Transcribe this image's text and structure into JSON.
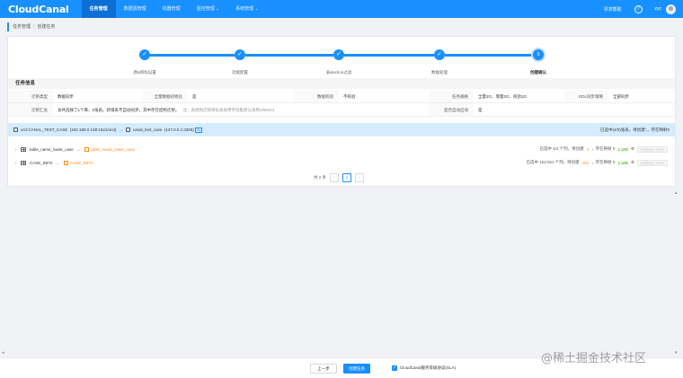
{
  "app": {
    "logo": "CloudCanal",
    "nav": [
      "任务管理",
      "数据源管理",
      "机器管理",
      "监控管理",
      "系统管理"
    ],
    "nav_dropdowns": [
      "监控管理",
      "系统管理"
    ],
    "active_nav": "任务管理",
    "consult": "寻求帮助",
    "help_icon": "?",
    "user": "zyc"
  },
  "breadcrumb": [
    "任务管理",
    "创建任务"
  ],
  "steps": [
    {
      "label": "源&目标设置",
      "icon": "✓"
    },
    {
      "label": "功能配置",
      "icon": "✓"
    },
    {
      "label": "表&action过滤",
      "icon": "✓"
    },
    {
      "label": "数据处理",
      "icon": "✓"
    },
    {
      "label": "创建确认",
      "icon": "5"
    }
  ],
  "section_title": "任务信息",
  "info": {
    "row1": [
      {
        "label": "迁移类型",
        "value": "数据同步"
      },
      {
        "label": "全量数据初始化",
        "value": "是"
      },
      {
        "label": "数据校验",
        "value": "不校验"
      },
      {
        "label": "任务规格",
        "value": "全量2G、增量2G、校验2G"
      },
      {
        "label": "DDL同步策略",
        "value": "全部同步"
      }
    ],
    "row2": {
      "label1": "迁移汇总",
      "value1": "总共选择了1个库、2张表。新增表不自动同步。其中存在结构迁移。",
      "note": "注：表结构迁移目标表采用字符集默认采用utf8mb4",
      "label2": "是否自动启动",
      "value2": "是"
    }
  },
  "db_bar": {
    "source": "orcl:CANAL_TEST_CASE",
    "source_addr": "(192.168.0.148:1521/orcl)",
    "target": "canal_test_case",
    "target_addr": "(127.0.0.1:3306)",
    "tag": "SL",
    "summary": "已选中(4/0)张表，待创建：，存在映射0"
  },
  "tables": [
    {
      "source": "table_name_lower_case",
      "target": "table_name_lower_case",
      "stats_prefix": "已选中 4/4 个列，待创建",
      "pending": "4",
      "mapping": "，存在映射 0",
      "uid": "1 UID",
      "placeholder": "设置数据过滤条件"
    },
    {
      "source": "CASE_INFO",
      "target": "CASE_INFO",
      "stats_prefix": "已选中 151/151 个列，待创建",
      "pending": "151",
      "mapping": "，存在映射 0",
      "uid": "1 UID",
      "placeholder": "设置数据过滤条件"
    }
  ],
  "pager": {
    "total": "共 2 条",
    "prev": "‹",
    "page": "1",
    "next": "›"
  },
  "footer": {
    "prev": "上一步",
    "create": "创建任务",
    "sla": "CloudCanal服务等级协议(SLA)",
    "sla_checked": "✓"
  },
  "watermark": "@稀土掘金技术社区",
  "colors": {
    "primary": "#1890ff",
    "orange": "#fa8c16",
    "green": "#52c41a"
  }
}
